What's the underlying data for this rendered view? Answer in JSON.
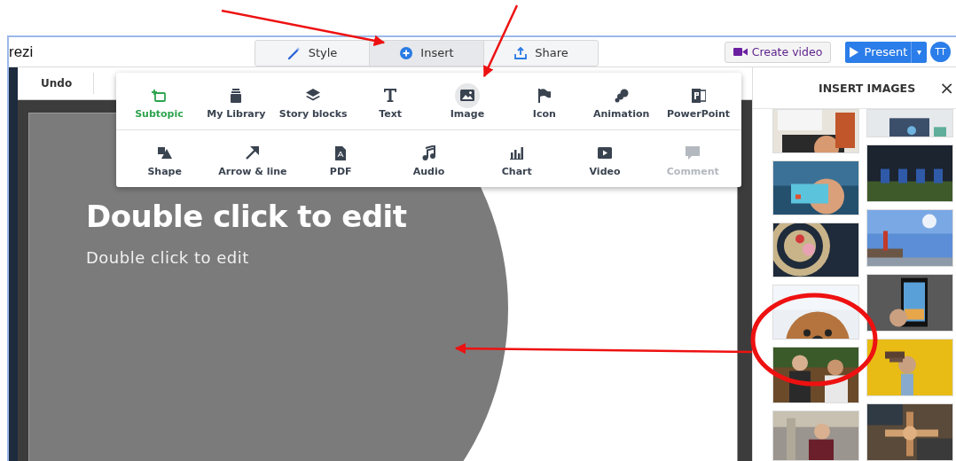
{
  "app": {
    "title": "rezi"
  },
  "tabs": [
    {
      "label": "Style",
      "selected": false
    },
    {
      "label": "Insert",
      "selected": true
    },
    {
      "label": "Share",
      "selected": false
    }
  ],
  "create_video": {
    "label": "Create video"
  },
  "present": {
    "label": "Present",
    "caret": "▾"
  },
  "avatar": {
    "initials": "TT"
  },
  "toolbar": [
    {
      "label": "Undo"
    }
  ],
  "insert_menu": [
    [
      {
        "label": "Subtopic",
        "kind": "accent",
        "selected": false,
        "disabled": false
      },
      {
        "label": "My Library",
        "kind": "tool",
        "selected": false,
        "disabled": false
      },
      {
        "label": "Story blocks",
        "kind": "tool",
        "selected": false,
        "disabled": false
      },
      {
        "label": "Text",
        "kind": "tool",
        "selected": false,
        "disabled": false
      },
      {
        "label": "Image",
        "kind": "tool",
        "selected": true,
        "disabled": false
      },
      {
        "label": "Icon",
        "kind": "tool",
        "selected": false,
        "disabled": false
      },
      {
        "label": "Animation",
        "kind": "tool",
        "selected": false,
        "disabled": false
      },
      {
        "label": "PowerPoint",
        "kind": "tool",
        "selected": false,
        "disabled": false
      }
    ],
    [
      {
        "label": "Shape",
        "kind": "tool",
        "selected": false,
        "disabled": false
      },
      {
        "label": "Arrow & line",
        "kind": "tool",
        "selected": false,
        "disabled": false
      },
      {
        "label": "PDF",
        "kind": "tool",
        "selected": false,
        "disabled": false
      },
      {
        "label": "Audio",
        "kind": "tool",
        "selected": false,
        "disabled": false
      },
      {
        "label": "Chart",
        "kind": "tool",
        "selected": false,
        "disabled": false
      },
      {
        "label": "Video",
        "kind": "tool",
        "selected": false,
        "disabled": false
      },
      {
        "label": "Comment",
        "kind": "tool",
        "selected": false,
        "disabled": true
      }
    ]
  ],
  "slide": {
    "title": "Double click to edit",
    "subtitle": "Double click to edit"
  },
  "images_panel": {
    "title": "INSERT IMAGES",
    "close": "×"
  }
}
